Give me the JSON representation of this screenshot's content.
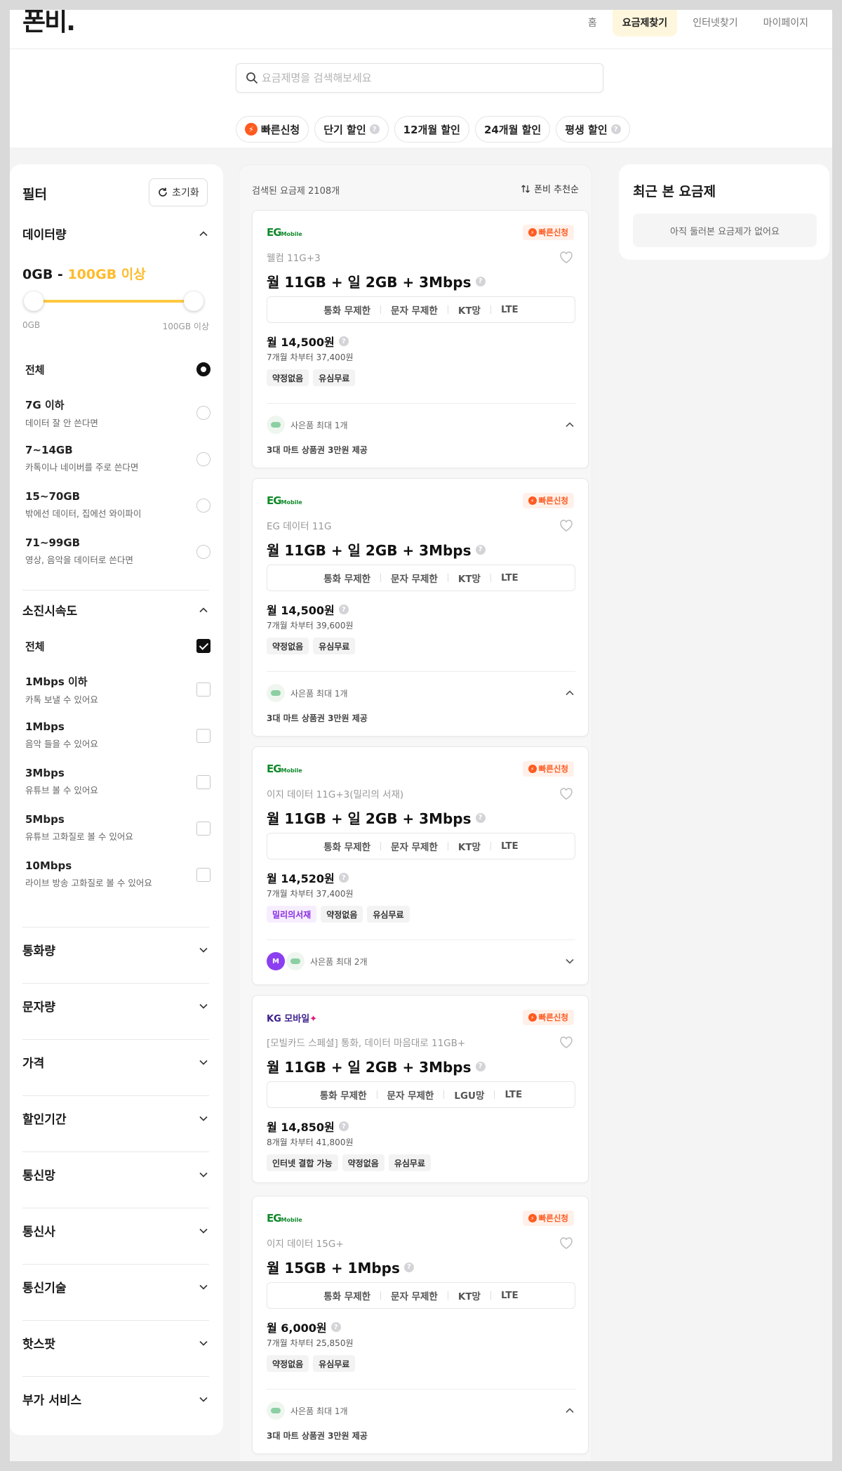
{
  "header": {
    "logo": "폰비.",
    "nav": [
      "홈",
      "요금제찾기",
      "인터넷찾기",
      "마이페이지"
    ],
    "active_nav": 1
  },
  "search": {
    "placeholder": "요금제명을 검색해보세요"
  },
  "chips": [
    {
      "label": "빠른신청",
      "icon": "bolt-icon",
      "help": false
    },
    {
      "label": "단기 할인",
      "help": true
    },
    {
      "label": "12개월 할인",
      "help": false
    },
    {
      "label": "24개월 할인",
      "help": false
    },
    {
      "label": "평생 할인",
      "help": true
    }
  ],
  "filter": {
    "title": "필터",
    "reset_label": "초기화",
    "data": {
      "label": "데이터량",
      "range_low": "0GB",
      "range_sep": " - ",
      "range_high": "100GB 이상",
      "min_label": "0GB",
      "max_label": "100GB 이상",
      "options": [
        {
          "title": "전체",
          "sub": "",
          "selected": true
        },
        {
          "title": "7G 이하",
          "sub": "데이터 잘 안 쓴다면",
          "selected": false
        },
        {
          "title": "7~14GB",
          "sub": "카톡이나 네이버를 주로 쓴다면",
          "selected": false
        },
        {
          "title": "15~70GB",
          "sub": "밖에선 데이터, 집에선 와이파이",
          "selected": false
        },
        {
          "title": "71~99GB",
          "sub": "영상, 음악을 데이터로 쓴다면",
          "selected": false
        }
      ]
    },
    "speed": {
      "label": "소진시속도",
      "options": [
        {
          "title": "전체",
          "sub": "",
          "checked": true
        },
        {
          "title": "1Mbps 이하",
          "sub": "카톡 보낼 수 있어요",
          "checked": false
        },
        {
          "title": "1Mbps",
          "sub": "음악 들을 수 있어요",
          "checked": false
        },
        {
          "title": "3Mbps",
          "sub": "유튜브 볼 수 있어요",
          "checked": false
        },
        {
          "title": "5Mbps",
          "sub": "유튜브 고화질로 볼 수 있어요",
          "checked": false
        },
        {
          "title": "10Mbps",
          "sub": "라이브 방송 고화질로 볼 수 있어요",
          "checked": false
        }
      ]
    },
    "collapsed": [
      "통화량",
      "문자량",
      "가격",
      "할인기간",
      "통신망",
      "통신사",
      "통신기술",
      "핫스팟",
      "부가 서비스"
    ]
  },
  "results": {
    "count_label": "검색된 요금제 2108개",
    "sort_label": "폰비 추천순",
    "quick_label": "빠른신청",
    "cards": [
      {
        "brand": "EG",
        "brand_sub": "Mobile",
        "name": "웰컴 11G+3",
        "spec": "월 11GB + 일 2GB + 3Mbps",
        "features": [
          "통화 무제한",
          "문자 무제한",
          "KT망",
          "LTE"
        ],
        "price": "월 14,500원",
        "after": "7개월 차부터 37,400원",
        "tags": [
          "약정없음",
          "유심무료"
        ],
        "gift": "사은품 최대 1개",
        "gift_detail": "3대 마트 상품권 3만원 제공",
        "expanded": true
      },
      {
        "brand": "EG",
        "brand_sub": "Mobile",
        "name": "EG 데이터 11G",
        "spec": "월 11GB + 일 2GB + 3Mbps",
        "features": [
          "통화 무제한",
          "문자 무제한",
          "KT망",
          "LTE"
        ],
        "price": "월 14,500원",
        "after": "7개월 차부터 39,600원",
        "tags": [
          "약정없음",
          "유심무료"
        ],
        "gift": "사은품 최대 1개",
        "gift_detail": "3대 마트 상품권 3만원 제공",
        "expanded": true
      },
      {
        "brand": "EG",
        "brand_sub": "Mobile",
        "name": "이지 데이터 11G+3(밀리의 서재)",
        "spec": "월 11GB + 일 2GB + 3Mbps",
        "features": [
          "통화 무제한",
          "문자 무제한",
          "KT망",
          "LTE"
        ],
        "price": "월 14,520원",
        "after": "7개월 차부터 37,400원",
        "tags": [
          "밀리의서재",
          "약정없음",
          "유심무료"
        ],
        "gift": "사은품 최대 2개",
        "gift_detail": "",
        "expanded": false
      },
      {
        "brand": "KG 모바일",
        "brand_sub": "",
        "name": "[모빌카드 스페셜] 통화, 데이터 마음대로 11GB+",
        "spec": "월 11GB + 일 2GB + 3Mbps",
        "features": [
          "통화 무제한",
          "문자 무제한",
          "LGU망",
          "LTE"
        ],
        "price": "월 14,850원",
        "after": "8개월 차부터 41,800원",
        "tags": [
          "인터넷 결합 가능",
          "약정없음",
          "유심무료"
        ],
        "gift": "",
        "gift_detail": "",
        "expanded": false
      },
      {
        "brand": "EG",
        "brand_sub": "Mobile",
        "name": "이지 데이터 15G+",
        "spec": "월 15GB + 1Mbps",
        "features": [
          "통화 무제한",
          "문자 무제한",
          "KT망",
          "LTE"
        ],
        "price": "월 6,000원",
        "after": "7개월 차부터 25,850원",
        "tags": [
          "약정없음",
          "유심무료"
        ],
        "gift": "사은품 최대 1개",
        "gift_detail": "3대 마트 상품권 3만원 제공",
        "expanded": true
      }
    ]
  },
  "recent": {
    "title": "최근 본 요금제",
    "empty": "아직 둘러본 요금제가 없어요"
  },
  "colors": {
    "accent": "#ffbb2c",
    "quick": "#ff5a1f",
    "brand_eg": "#128a2c",
    "brand_kg": "#3b1f8b"
  }
}
